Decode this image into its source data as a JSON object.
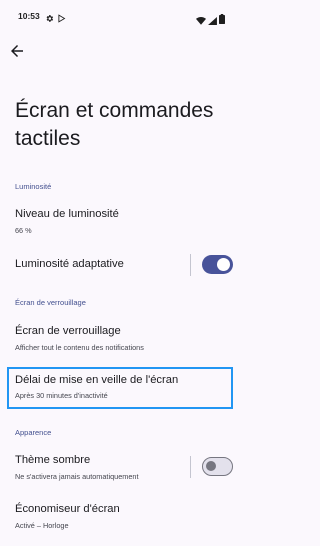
{
  "status_bar": {
    "time": "10:53",
    "icons": [
      "gear-icon",
      "play-store-icon",
      "wifi-icon",
      "signal-icon",
      "battery-icon"
    ]
  },
  "page": {
    "title": "Écran et commandes tactiles"
  },
  "sections": {
    "brightness": {
      "header": "Luminosité",
      "level_title": "Niveau de luminosité",
      "level_value": "66 %",
      "adaptive_title": "Luminosité adaptative",
      "adaptive_enabled": true
    },
    "lock_screen": {
      "header": "Écran de verrouillage",
      "lock_title": "Écran de verrouillage",
      "lock_sub": "Afficher tout le contenu des notifications",
      "timeout_title": "Délai de mise en veille de l'écran",
      "timeout_sub": "Après 30 minutes d'inactivité"
    },
    "appearance": {
      "header": "Apparence",
      "dark_title": "Thème sombre",
      "dark_sub": "Ne s'activera jamais automatiquement",
      "dark_enabled": false,
      "saver_title": "Économiseur d'écran",
      "saver_sub": "Activé – Horloge"
    }
  },
  "colors": {
    "accent": "#48539a",
    "section_header": "#43508f",
    "highlight": "#2196f3",
    "background": "#fbf8fd"
  }
}
